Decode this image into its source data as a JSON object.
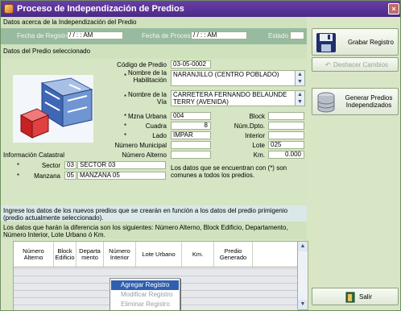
{
  "window": {
    "title": "Proceso de Independización de Predios",
    "close": "×"
  },
  "sections": {
    "datos_independizacion": "Datos acerca de la Independización del Predio",
    "datos_predio": "Datos del Predio seleccionado",
    "info_catastral": "Información Catastral",
    "nuevos_predios": "Ingrese los datos de los nuevos predios que se crearán en función a los datos del predio primigenio (predio actualmente seleccionado).",
    "diferencia": "Los datos que harán la diferencia son los siguientes: Número Alterno, Block Edificio, Departamento, Número Interior, Lote Urbano ó Km."
  },
  "registro": {
    "fecha_registro_label": "Fecha de Registro",
    "fecha_registro_value": "/ /   : : AM",
    "fecha_proceso_label": "Fecha de Proceso",
    "fecha_proceso_value": "/ /   : : AM",
    "estado_label": "Estado",
    "estado_value": ""
  },
  "predio": {
    "codigo_label": "Código de Predio",
    "codigo_value": "03-05-0002",
    "habilitacion_label": "Nombre de la Habilitación",
    "habilitacion_value": "NARANJILLO (CENTRO POBLADO)",
    "via_label": "Nombre de la Vía",
    "via_value": "CARRETERA FERNANDO BELAUNDE TERRY (AVENIDA)",
    "mzna_label": "Mzna Urbana",
    "mzna_value": "004",
    "cuadra_label": "Cuadra",
    "cuadra_value": "8",
    "lado_label": "Lado",
    "lado_value": "IMPAR",
    "num_municipal_label": "Número Municipal",
    "num_municipal_value": "",
    "num_alterno_label": "Número Alterno",
    "num_alterno_value": "",
    "block_label": "Block",
    "block_value": "",
    "num_dpto_label": "Núm.Dpto.",
    "num_dpto_value": "",
    "interior_label": "Interior",
    "interior_value": "",
    "lote_label": "Lote",
    "lote_value": "025",
    "km_label": "Km.",
    "km_value": "0.000",
    "asterisk": "*"
  },
  "catastral": {
    "sector_label": "Sector",
    "sector_code": "03",
    "sector_value": "SECTOR 03",
    "manzana_label": "Manzana",
    "manzana_code": "05",
    "manzana_value": "MANZANA 05",
    "note": "Los datos que se encuentran con (*) son comunes a todos los predios."
  },
  "table": {
    "headers": [
      "Número Alterno",
      "Block Edificio",
      "Departa mento",
      "Número Interior",
      "Lote Urbano",
      "Km.",
      "Predio Generado"
    ]
  },
  "context_menu": {
    "agregar": "Agregar Registro",
    "modificar": "Modificar Registro",
    "eliminar": "Eliminar Registro"
  },
  "buttons": {
    "grabar": "Grabar Registro",
    "deshacer": "Deshacer Cambios",
    "generar": "Generar Predios Independizados",
    "salir": "Salir"
  }
}
